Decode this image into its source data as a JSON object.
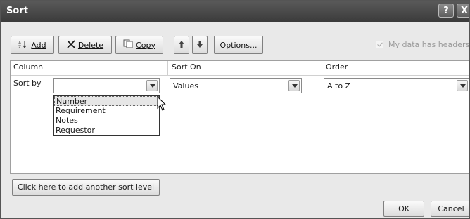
{
  "window": {
    "title": "Sort",
    "help_label": "?",
    "close_label": "X"
  },
  "toolbar": {
    "add_label": "Add",
    "delete_label": "Delete",
    "copy_label": "Copy",
    "options_label": "Options..."
  },
  "checkbox": {
    "label": "My data has headers",
    "checked": true
  },
  "columns": {
    "column": "Column",
    "sort_on": "Sort On",
    "order": "Order"
  },
  "row": {
    "label": "Sort by",
    "column_value": "",
    "sort_on_value": "Values",
    "order_value": "A to Z"
  },
  "dropdown": {
    "items": [
      "Number",
      "Requirement",
      "Notes",
      "Requestor"
    ],
    "selected_index": 0
  },
  "add_level_label": "Click here to add another sort level",
  "ok_label": "OK",
  "cancel_label": "Cancel"
}
